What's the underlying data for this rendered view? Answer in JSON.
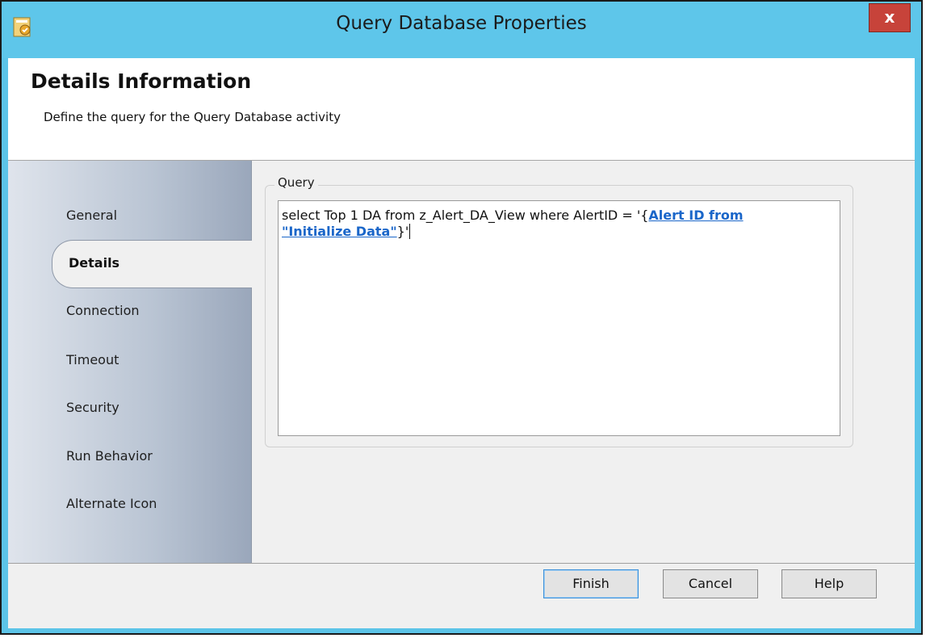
{
  "window": {
    "title": "Query Database Properties",
    "close_glyph": "x",
    "app_icon": "activity-icon",
    "accent_color": "#5ec6ea",
    "close_color": "#c7433a"
  },
  "header": {
    "title": "Details Information",
    "subtitle": "Define the query for the Query Database activity"
  },
  "nav": {
    "items": [
      {
        "label": "General"
      },
      {
        "label": "Details",
        "selected": true
      },
      {
        "label": "Connection"
      },
      {
        "label": "Timeout"
      },
      {
        "label": "Security"
      },
      {
        "label": "Run Behavior"
      },
      {
        "label": "Alternate Icon"
      }
    ]
  },
  "query": {
    "group_label": "Query",
    "text_before": "select Top 1 DA from z_Alert_DA_View where AlertID = '{",
    "link_line1": "Alert ID from",
    "link_line2": "\"Initialize Data\"",
    "text_after": "}'"
  },
  "footer": {
    "finish_label": "Finish",
    "cancel_label": "Cancel",
    "help_label": "Help"
  }
}
